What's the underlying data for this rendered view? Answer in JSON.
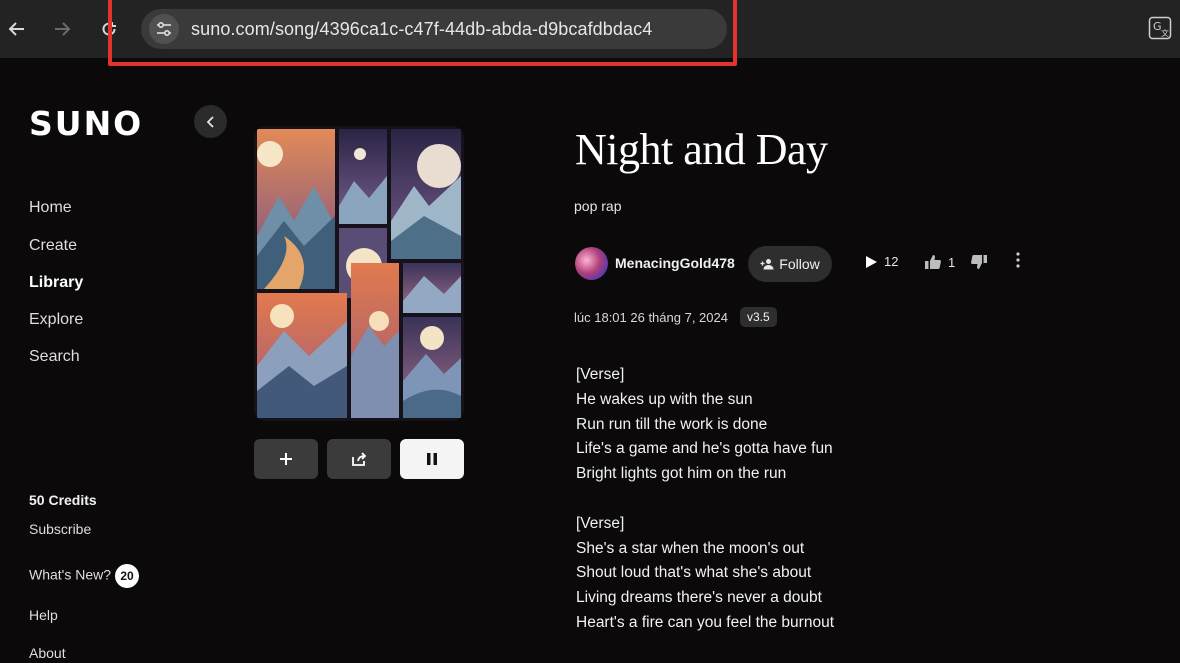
{
  "browser": {
    "url": "suno.com/song/4396ca1c-c47f-44db-abda-d9bcafdbdac4"
  },
  "sidebar": {
    "logo": "SUNO",
    "nav": [
      "Home",
      "Create",
      "Library",
      "Explore",
      "Search"
    ],
    "active": "Library",
    "credits": "50 Credits",
    "subscribe": "Subscribe",
    "whats_new": "What's New?",
    "whats_new_count": "20",
    "help": "Help",
    "about": "About"
  },
  "song": {
    "title": "Night and Day",
    "genre": "pop rap",
    "artist": "MenacingGold478",
    "follow_label": "Follow",
    "plays": "12",
    "likes": "1",
    "timestamp": "lúc 18:01 26 tháng 7, 2024",
    "version": "v3.5",
    "lyrics": [
      "[Verse]",
      "He wakes up with the sun",
      "Run run till the work is done",
      "Life's a game and he's gotta have fun",
      "Bright lights got him on the run",
      "",
      "[Verse]",
      "She's a star when the moon's out",
      "Shout loud that's what she's about",
      "Living dreams there's never a doubt",
      "Heart's a fire can you feel the burnout"
    ]
  },
  "icons": {
    "back": "arrow-left-icon",
    "forward": "arrow-right-icon",
    "reload": "reload-icon",
    "site_info": "tune-icon",
    "translate": "translate-icon",
    "collapse": "chevron-left-icon",
    "add": "plus-icon",
    "share": "share-icon",
    "pause": "pause-icon",
    "play": "play-icon",
    "like": "thumbs-up-icon",
    "dislike": "thumbs-down-icon",
    "more": "more-vertical-icon"
  },
  "colors": {
    "highlight": "#e2332f",
    "background": "#0b0909"
  }
}
